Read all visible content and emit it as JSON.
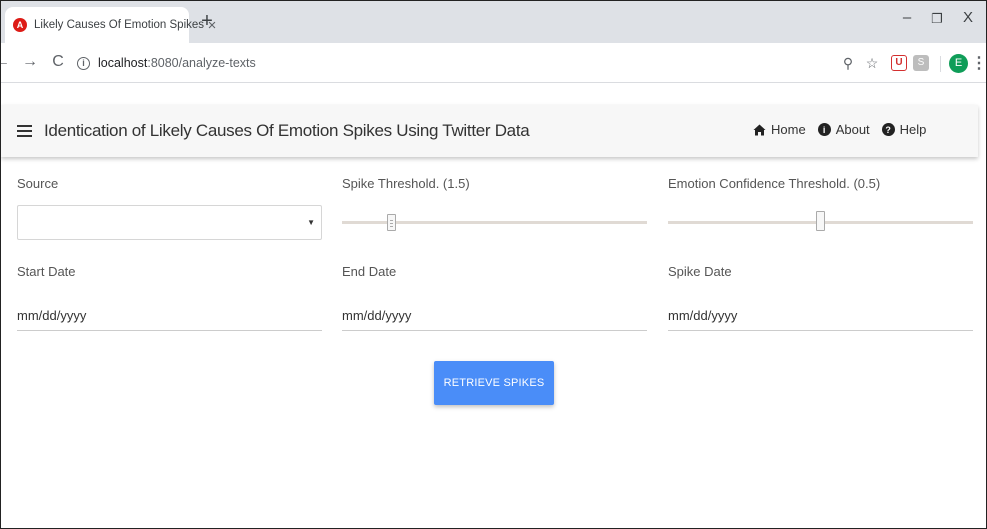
{
  "browser": {
    "tab_title": "Likely Causes Of Emotion Spikes",
    "tab_close": "×",
    "new_tab": "+",
    "url_host": "localhost",
    "url_path": ":8080/analyze-texts",
    "profile_initial": "E",
    "window_controls": {
      "minimize": "–",
      "restore": "❐",
      "close": "X"
    },
    "icons": [
      "back-icon",
      "forward-icon",
      "reload-icon",
      "info-icon",
      "zoom-icon",
      "star-icon",
      "extension-icon",
      "profile-icon",
      "menu-icon"
    ]
  },
  "appbar": {
    "title": "Identication of Likely Causes Of Emotion Spikes Using Twitter Data",
    "nav": {
      "home": "Home",
      "about": "About",
      "help": "Help"
    }
  },
  "form": {
    "source": {
      "label": "Source",
      "value": ""
    },
    "spike_threshold": {
      "label": "Spike Threshold. (1.5)",
      "value": 1.5,
      "level_fraction": 0.16
    },
    "emotion_confidence": {
      "label": "Emotion Confidence Threshold. (0.5)",
      "value": 0.5,
      "level_fraction": 0.5
    },
    "start_date": {
      "label": "Start Date",
      "placeholder": "mm/dd/yyyy"
    },
    "end_date": {
      "label": "End Date",
      "placeholder": "mm/dd/yyyy"
    },
    "spike_date": {
      "label": "Spike Date",
      "placeholder": "mm/dd/yyyy"
    },
    "submit_label": "RETRIEVE SPIKES"
  },
  "colors": {
    "button": "#4a8df8",
    "appbar": "#f7f7f7",
    "favicon": "#dd1b16",
    "profile": "#0f9d58"
  }
}
